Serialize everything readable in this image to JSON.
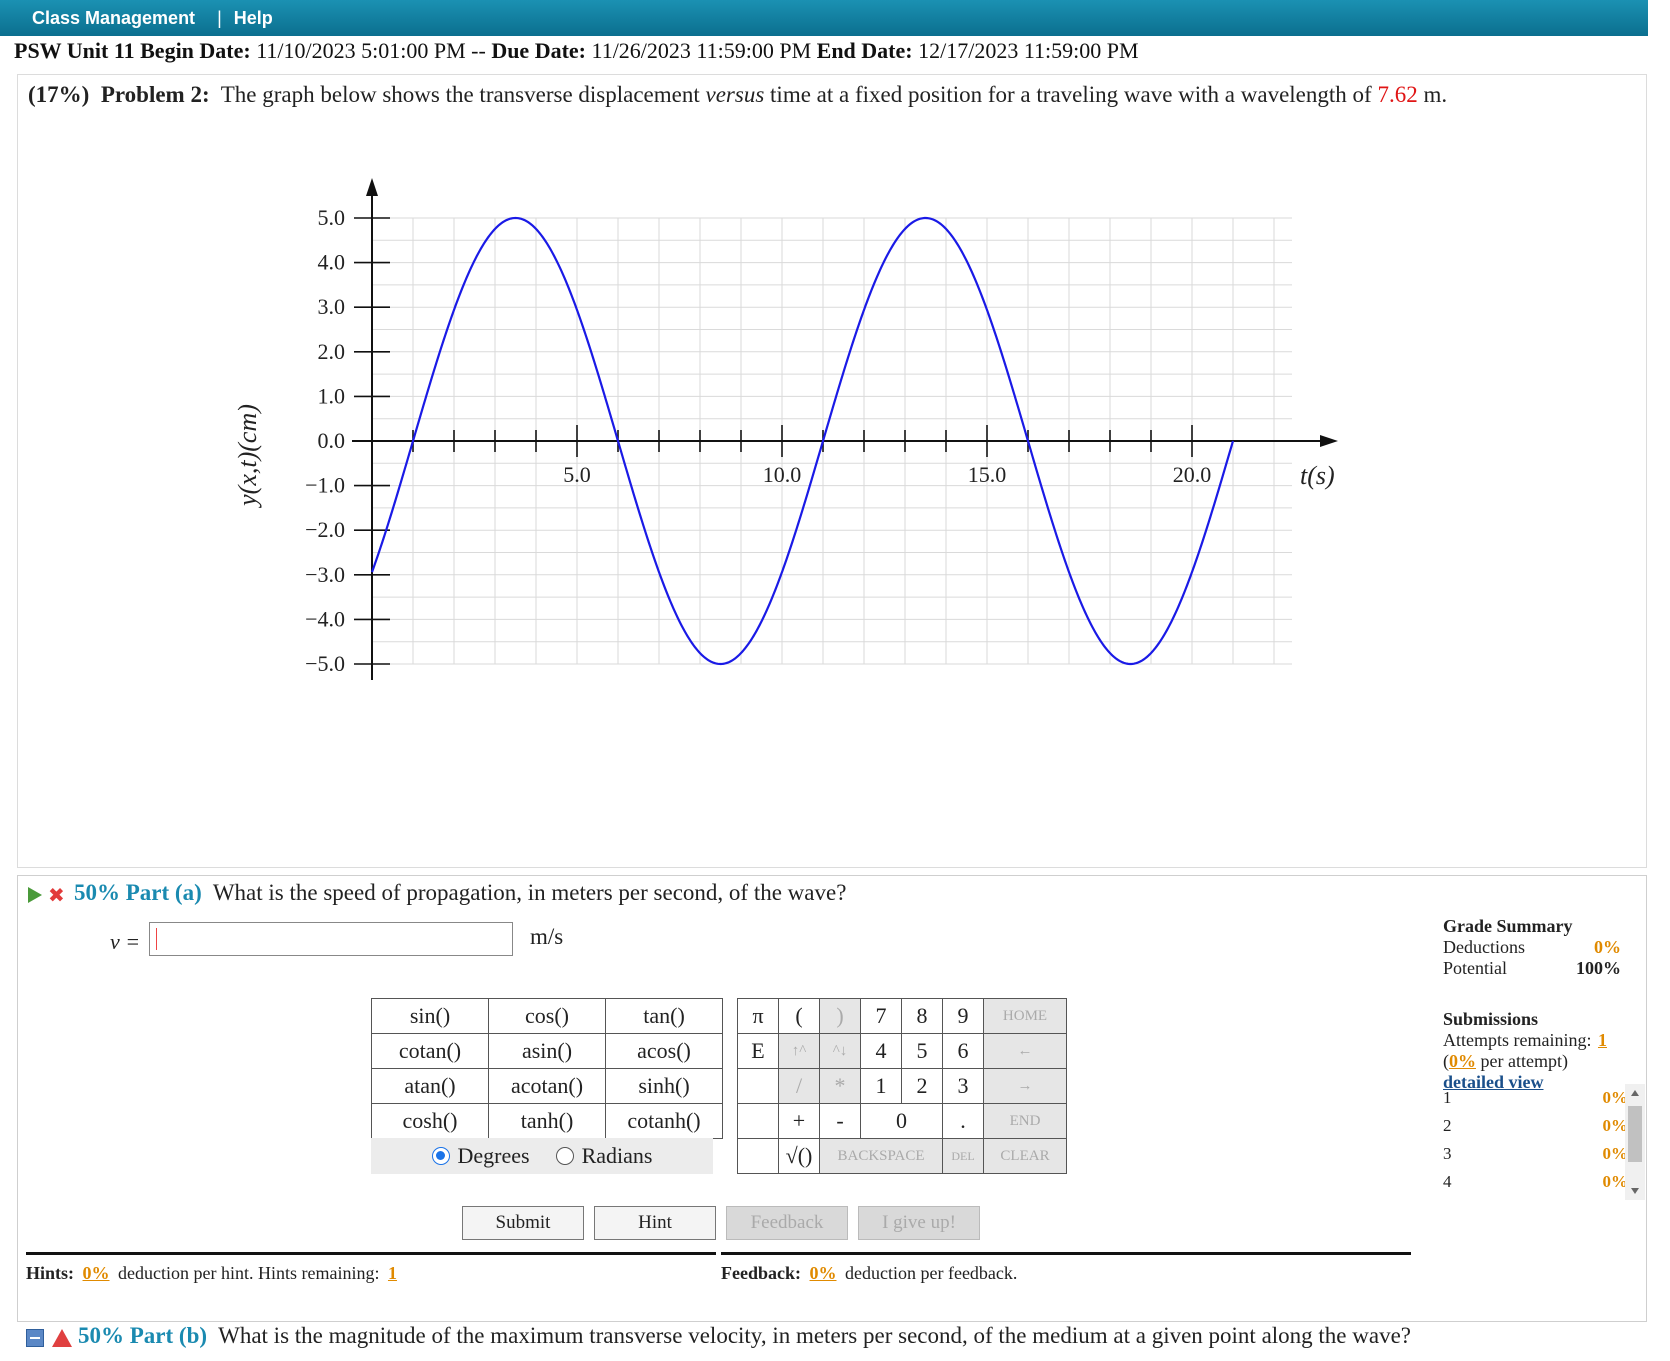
{
  "nav": {
    "item1": "Class Management",
    "separator": "|",
    "item2": "Help"
  },
  "dates": {
    "unit_label": "PSW Unit 11 Begin Date:",
    "begin": " 11/10/2023 5:01:00 PM -- ",
    "due_label": "Due Date:",
    "due": " 11/26/2023 11:59:00 PM ",
    "end_label": "End Date:",
    "end": " 12/17/2023 11:59:00 PM"
  },
  "problem": {
    "percent": "(17%)",
    "name": "Problem 2:",
    "text_before": "The graph below shows the transverse displacement ",
    "text_italic": "versus",
    "text_after": " time at a fixed position for a traveling wave with a wavelength of ",
    "value": "7.62",
    "unit": " m."
  },
  "chart_data": {
    "type": "line",
    "xlabel": "t(s)",
    "ylabel": "y(x,t)(cm)",
    "xlim": [
      -0.2,
      21.5
    ],
    "ylim": [
      -5.0,
      5.0
    ],
    "x_ticks": [
      "5.0",
      "10.0",
      "15.0",
      "20.0"
    ],
    "y_ticks": [
      "5.0",
      "4.0",
      "3.0",
      "2.0",
      "1.0",
      "0.0",
      "−1.0",
      "−2.0",
      "−3.0",
      "−4.0",
      "−5.0"
    ],
    "grid": true,
    "series": [
      {
        "amplitude_cm": 5.0,
        "period_s": 10.0,
        "phase_shift_s": 1.0,
        "x_start": 0.0,
        "x_end": 21.0,
        "color": "#1a1ae6"
      }
    ]
  },
  "part_a": {
    "percent_part": "50% Part (a)",
    "question": "What is the speed of propagation, in meters per second, of the wave?",
    "var_label": "v =",
    "unit": "m/s"
  },
  "keypad": {
    "func_rows": [
      [
        "sin()",
        "cos()",
        "tan()"
      ],
      [
        "cotan()",
        "asin()",
        "acos()"
      ],
      [
        "atan()",
        "acotan()",
        "sinh()"
      ],
      [
        "cosh()",
        "tanh()",
        "cotanh()"
      ]
    ],
    "degrees": "Degrees",
    "radians": "Radians",
    "pi": "π",
    "lparen": "(",
    "rparen": ")",
    "e": "E",
    "up": "↑^",
    "down": "^↓",
    "slash": "/",
    "star": "*",
    "plus": "+",
    "minus": "-",
    "zero": "0",
    "dot": ".",
    "sqrt": "√()",
    "n7": "7",
    "n8": "8",
    "n9": "9",
    "n4": "4",
    "n5": "5",
    "n6": "6",
    "n1": "1",
    "n2": "2",
    "n3": "3",
    "home": "HOME",
    "left": "←",
    "right": "→",
    "end": "END",
    "backspace": "BACKSPACE",
    "del": "DEL",
    "clear": "CLEAR"
  },
  "buttons": {
    "submit": "Submit",
    "hint": "Hint",
    "feedback": "Feedback",
    "give_up": "I give up!"
  },
  "hints": {
    "label": "Hints:",
    "deduction": "0%",
    "text": "deduction per hint. Hints remaining:",
    "remaining": "1"
  },
  "feedback": {
    "label": "Feedback:",
    "deduction": "0%",
    "text": "deduction per feedback."
  },
  "grade_summary": {
    "title": "Grade Summary",
    "deductions_label": "Deductions",
    "deductions": "0%",
    "potential_label": "Potential",
    "potential": "100%"
  },
  "submissions": {
    "title": "Submissions",
    "attempts_label": "Attempts remaining:",
    "attempts": "1",
    "per_attempt_pct": "0%",
    "per_attempt_text": "per attempt)",
    "paren_open": "(",
    "detailed": "detailed view",
    "rows": [
      {
        "n": "1",
        "pct": "0%"
      },
      {
        "n": "2",
        "pct": "0%"
      },
      {
        "n": "3",
        "pct": "0%"
      },
      {
        "n": "4",
        "pct": "0%"
      }
    ]
  },
  "part_b": {
    "percent_part": "50% Part (b)",
    "question": "What is the magnitude of the maximum transverse velocity, in meters per second, of the medium at a given point along the wave?"
  },
  "colors": {
    "accent": "#1a8ab0",
    "value_red": "#e01515",
    "orange": "#e08a00",
    "curve": "#1a1ae6"
  }
}
